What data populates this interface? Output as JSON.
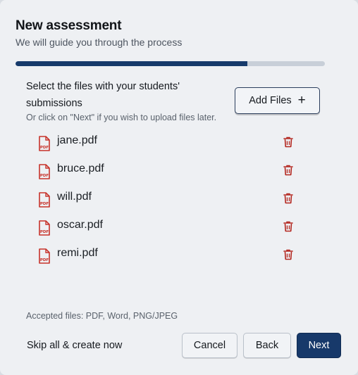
{
  "dialog": {
    "title": "New assessment",
    "subtitle": "We will guide you through the process",
    "progress": 0.75
  },
  "upload": {
    "instruction": "Select the files with your students' submissions",
    "hint": "Or click on \"Next\" if you wish to upload files later.",
    "add_files_label": "Add Files",
    "add_files_icon": "plus-icon",
    "file_icon": "pdf-icon",
    "delete_icon": "trash-icon",
    "files": [
      {
        "name": "jane.pdf"
      },
      {
        "name": "bruce.pdf"
      },
      {
        "name": "will.pdf"
      },
      {
        "name": "oscar.pdf"
      },
      {
        "name": "remi.pdf"
      }
    ],
    "accepted": "Accepted files: PDF, Word, PNG/JPEG"
  },
  "footer": {
    "skip_label": "Skip all & create now",
    "cancel_label": "Cancel",
    "back_label": "Back",
    "next_label": "Next"
  },
  "colors": {
    "primary": "#17396a",
    "pdf_red": "#c7332b",
    "delete_red": "#b3261e",
    "progress_track": "#c8cfd8"
  }
}
